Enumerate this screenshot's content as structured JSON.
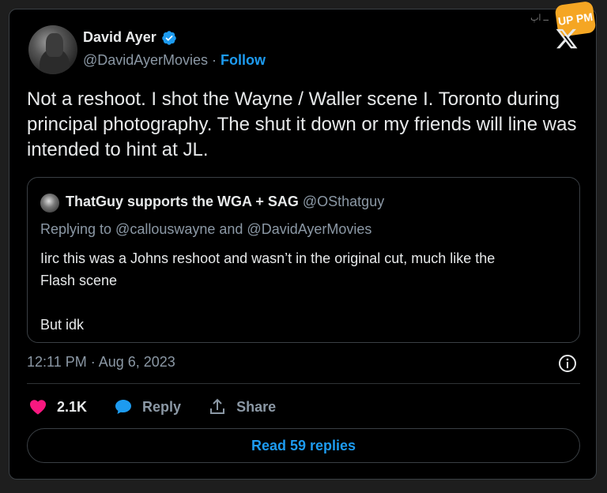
{
  "author": {
    "name": "David Ayer",
    "handle": "@DavidAyerMovies",
    "separator": "·",
    "follow_label": "Follow"
  },
  "tweet": {
    "text": "Not a reshoot. I shot the Wayne / Waller scene I. Toronto during principal photography. The shut it down or my friends will line was intended to hint at JL.",
    "timestamp": "12:11 PM · Aug 6, 2023"
  },
  "quote": {
    "name": "ThatGuy supports the WGA + SAG",
    "handle": "@OSthatguy",
    "replying_to": "Replying to @callouswayne and @DavidAyerMovies",
    "text_line1": "Iirc this was a Johns reshoot and wasn’t in the original cut, much like the",
    "text_line2": "Flash scene",
    "text_line3": "But idk"
  },
  "actions": {
    "likes": "2.1K",
    "reply_label": "Reply",
    "share_label": "Share",
    "read_replies": "Read 59 replies"
  },
  "watermark": {
    "text": "UP PM"
  },
  "colors": {
    "accent": "#1d9bf0",
    "like": "#f91880",
    "background": "#000000"
  },
  "icons": [
    "verified-badge-icon",
    "x-logo-icon",
    "info-icon",
    "heart-icon",
    "reply-bubble-icon",
    "share-icon"
  ]
}
